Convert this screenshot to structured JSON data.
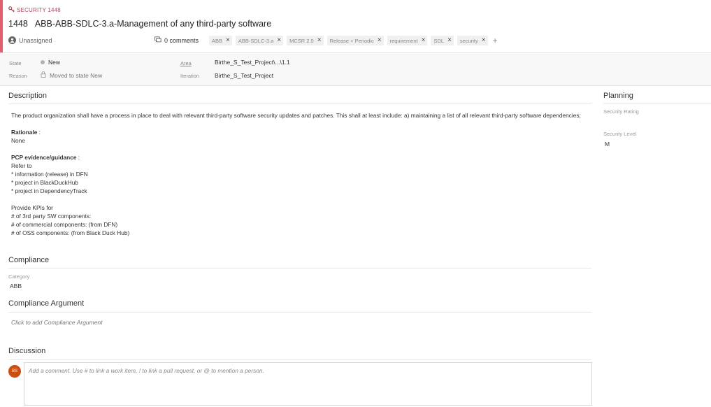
{
  "work_item": {
    "type_label": "SECURITY 1448",
    "id": "1448",
    "title": "ABB-ABB-SDLC-3.a-Management of any third-party software",
    "assigned": "Unassigned",
    "comments": "0 comments"
  },
  "tags": [
    "ABB",
    "ABB-SDLC-3.a",
    "MCSR 2.0",
    "Release + Periodic",
    "requirement",
    "SDL",
    "security"
  ],
  "fields": {
    "state_label": "State",
    "state_value": "New",
    "reason_label": "Reason",
    "reason_value": "Moved to state New",
    "area_label": "Area",
    "area_value": "Birthe_S_Test_Project\\...\\1.1",
    "iteration_label": "Iteration",
    "iteration_value": "Birthe_S_Test_Project"
  },
  "description": {
    "title": "Description",
    "intro": "The product organization shall have a process in place to deal with relevant third-party software security updates and patches. This shall at least include: a) maintaining a list of all relevant third-party software dependencies;",
    "rationale_label": "Rationale",
    "rationale_colon": " :",
    "rationale_value": "None",
    "pcp_label": "PCP evidence/guidance",
    "pcp_colon": " :",
    "pcp_lines": [
      "Refer to",
      "* information (release) in DFN",
      "* project in BlackDuckHub",
      "* project in DependencyTrack"
    ],
    "kpi_lines": [
      "Provide KPIs for",
      "# of 3rd party SW components:",
      "# of commercial components: (from DFN)",
      "# of OSS components: (from Black Duck Hub)"
    ]
  },
  "compliance": {
    "title": "Compliance",
    "category_label": "Category",
    "category_value": "ABB"
  },
  "compliance_argument": {
    "title": "Compliance Argument",
    "placeholder": "Click to add Compliance Argument"
  },
  "discussion": {
    "title": "Discussion",
    "avatar_initials": "BS",
    "placeholder": "Add a comment. Use # to link a work item, ! to link a pull request, or @ to mention a person."
  },
  "planning": {
    "title": "Planning",
    "security_rating_label": "Security Rating",
    "security_level_label": "Security Level",
    "security_level_value": "M"
  },
  "colors": {
    "accent": "#e05e6e",
    "avatar": "#ca5010"
  }
}
